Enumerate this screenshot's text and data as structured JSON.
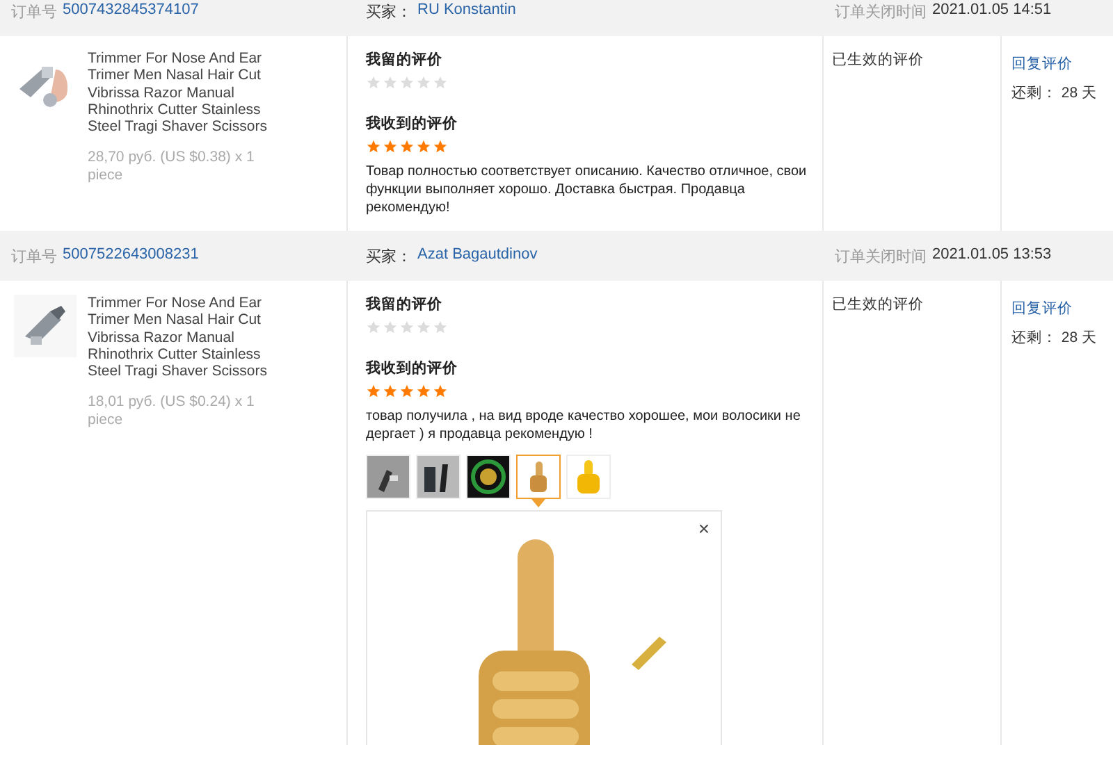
{
  "orders": [
    {
      "order_label": "订单号",
      "order_number": "5007432845374107",
      "buyer_label": "买家：",
      "buyer": "RU Konstantin",
      "closed_label": "订单关闭时间",
      "closed_time": "2021.01.05 14:51",
      "product": {
        "title": "Trimmer For Nose And Ear Trimer Men Nasal Hair Cut Vibrissa Razor Manual Rhinothrix Cutter Stainless Steel Tragi Shaver Scissors",
        "price": "28,70 руб. (US $0.38) x 1 piece"
      },
      "my_review": {
        "heading": "我留的评价",
        "stars": 0
      },
      "received_review": {
        "heading": "我收到的评价",
        "stars": 5,
        "text": "Товар полностью соответствует описанию. Качество отличное, свои функции выполняет хорошо. Доставка быстрая. Продавца рекомендую!"
      },
      "status": "已生效的评价",
      "reply_link": "回复评价",
      "remaining": "还剩： 28 天"
    },
    {
      "order_label": "订单号",
      "order_number": "5007522643008231",
      "buyer_label": "买家：",
      "buyer": "Azat Bagautdinov",
      "closed_label": "订单关闭时间",
      "closed_time": "2021.01.05 13:53",
      "product": {
        "title": "Trimmer For Nose And Ear Trimer Men Nasal Hair Cut Vibrissa Razor Manual Rhinothrix Cutter Stainless Steel Tragi Shaver Scissors",
        "price": "18,01 руб. (US $0.24) x 1 piece"
      },
      "my_review": {
        "heading": "我留的评价",
        "stars": 0
      },
      "received_review": {
        "heading": "我收到的评价",
        "stars": 5,
        "text": "товар получила , на вид вроде качество хорошее, мои волосики не дергает ) я продавца рекомендую !",
        "photos": [
          {
            "selected": false
          },
          {
            "selected": false
          },
          {
            "selected": false
          },
          {
            "selected": true
          },
          {
            "selected": false
          }
        ],
        "preview": {
          "close": "×"
        }
      },
      "status": "已生效的评价",
      "reply_link": "回复评价",
      "remaining": "还剩： 28 天"
    }
  ]
}
